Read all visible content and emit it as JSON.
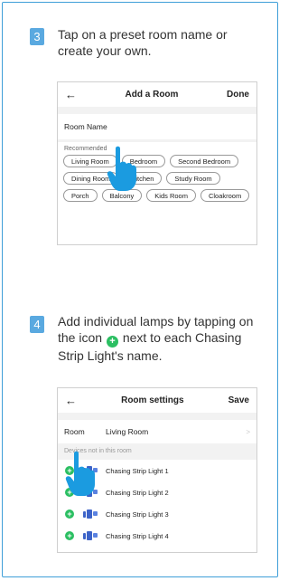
{
  "steps": [
    {
      "number": "3",
      "text": "Tap on a preset room name or create your own.",
      "screen": {
        "back_glyph": "←",
        "title": "Add a Room",
        "done_label": "Done",
        "room_name_label": "Room Name",
        "recommended_label": "Recommended",
        "chips": [
          "Living Room",
          "Bedroom",
          "Second Bedroom",
          "Dining Room",
          "Kitchen",
          "Study Room",
          "Porch",
          "Balcony",
          "Kids Room",
          "Cloakroom"
        ]
      }
    },
    {
      "number": "4",
      "text_before": "Add individual lamps by tapping on the icon",
      "text_after": "next to each Chasing Strip Light's name.",
      "plus_glyph": "+",
      "screen": {
        "back_glyph": "←",
        "title": "Room settings",
        "save_label": "Save",
        "room_label": "Room",
        "room_value": "Living Room",
        "chevron_glyph": ">",
        "devices_header": "Devices not in this room",
        "devices": [
          "Chasing Strip Light 1",
          "Chasing Strip Light 2",
          "Chasing Strip Light 3",
          "Chasing Strip Light 4"
        ]
      }
    }
  ],
  "colors": {
    "accent_blue": "#5aa9e0",
    "border_blue": "#3f9fd8",
    "add_green": "#2bbf62",
    "lamp_blue": "#3c63c8",
    "hand_blue": "#1b9be0"
  },
  "icons": [
    "back-arrow-icon",
    "add-plus-icon",
    "lamp-icon",
    "tap-hand-icon",
    "chevron-right-icon"
  ]
}
